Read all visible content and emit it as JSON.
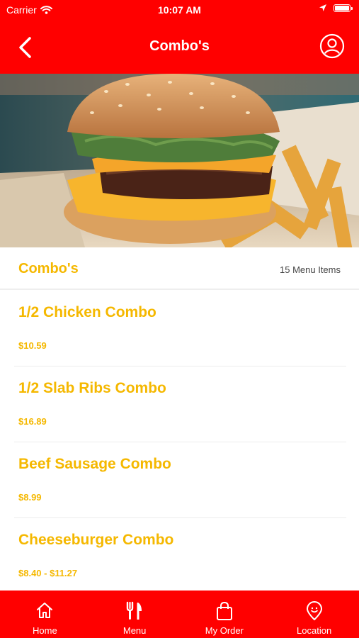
{
  "status_bar": {
    "carrier": "Carrier",
    "time": "10:07 AM"
  },
  "nav": {
    "title": "Combo's"
  },
  "section": {
    "title": "Combo's",
    "count": "15 Menu Items"
  },
  "items": [
    {
      "name": "1/2 Chicken Combo",
      "price": "$10.59"
    },
    {
      "name": "1/2 Slab Ribs Combo",
      "price": "$16.89"
    },
    {
      "name": "Beef Sausage Combo",
      "price": "$8.99"
    },
    {
      "name": "Cheeseburger Combo",
      "price": "$8.40 - $11.27"
    }
  ],
  "tabs": [
    {
      "label": "Home",
      "icon": "home-icon"
    },
    {
      "label": "Menu",
      "icon": "fork-knife-icon"
    },
    {
      "label": "My Order",
      "icon": "shopping-bag-icon"
    },
    {
      "label": "Location",
      "icon": "map-pin-icon"
    }
  ],
  "colors": {
    "brand_red": "#ff0000",
    "accent_yellow": "#f5b800"
  }
}
